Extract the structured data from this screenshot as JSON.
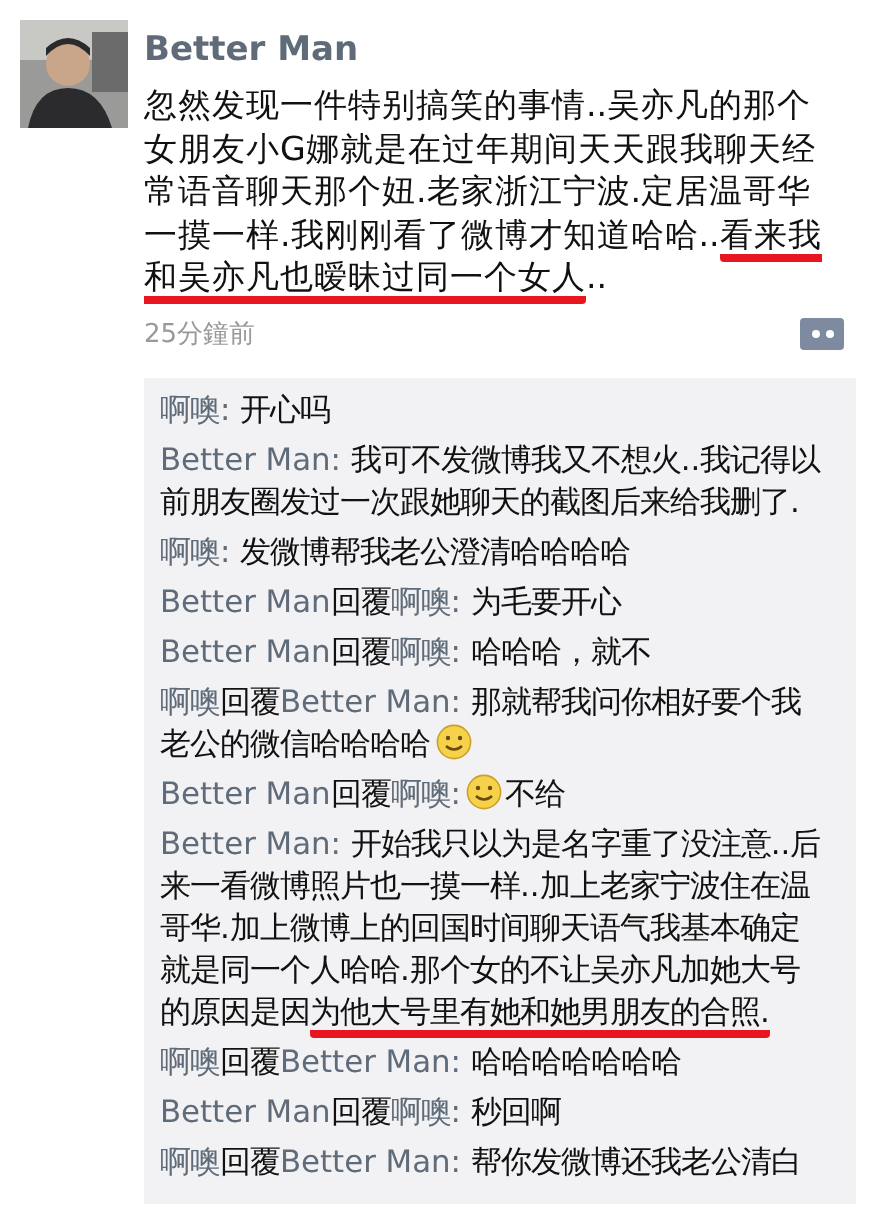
{
  "post": {
    "author": "Better Man",
    "text": [
      {
        "kind": "text",
        "text": "忽然发现一件特别搞笑的事情..吴亦凡的那个女朋友小G娜就是在过年期间天天跟我聊天经常语音聊天那个妞.老家浙江宁波.定居温哥华一摸一样.我刚刚看了微博才知道哈哈.."
      },
      {
        "kind": "underlined",
        "text": "看来我和吴亦凡也暧昧过同一个女人"
      },
      {
        "kind": "text",
        "text": ".."
      }
    ],
    "time": "25分鐘前"
  },
  "comments": [
    {
      "author": "啊噢:",
      "parts": [
        {
          "kind": "text",
          "text": " 开心吗"
        }
      ]
    },
    {
      "author": "Better Man:",
      "parts": [
        {
          "kind": "text",
          "text": " 我可不发微博我又不想火..我记得以前朋友圈发过一次跟她聊天的截图后来给我删了."
        }
      ]
    },
    {
      "author": "啊噢:",
      "parts": [
        {
          "kind": "text",
          "text": " 发微博帮我老公澄清哈哈哈哈"
        }
      ]
    },
    {
      "author": "Better Man",
      "reply_word": "回覆",
      "reply_to": "啊噢:",
      "parts": [
        {
          "kind": "text",
          "text": " 为毛要开心"
        }
      ]
    },
    {
      "author": "Better Man",
      "reply_word": "回覆",
      "reply_to": "啊噢:",
      "parts": [
        {
          "kind": "text",
          "text": " 哈哈哈，就不"
        }
      ]
    },
    {
      "author": "啊噢",
      "reply_word": "回覆",
      "reply_to": "Better Man:",
      "parts": [
        {
          "kind": "text",
          "text": " 那就帮我问你相好要个我老公的微信哈哈哈哈"
        },
        {
          "kind": "emoji"
        }
      ]
    },
    {
      "author": "Better Man",
      "reply_word": "回覆",
      "reply_to": "啊噢:",
      "parts": [
        {
          "kind": "emoji"
        },
        {
          "kind": "text",
          "text": "不给"
        }
      ]
    },
    {
      "author": "Better Man:",
      "parts": [
        {
          "kind": "text",
          "text": " 开始我只以为是名字重了没注意..后来一看微博照片也一摸一样..加上老家宁波住在温哥华.加上微博上的回国时间聊天语气我基本确定就是同一个人哈哈.那个女的不让吴亦凡加她大号的原因是因"
        },
        {
          "kind": "underlined",
          "text": "为他大号里有她和她男朋友的合照."
        }
      ]
    },
    {
      "author": "啊噢",
      "reply_word": "回覆",
      "reply_to": "Better Man:",
      "parts": [
        {
          "kind": "text",
          "text": " 哈哈哈哈哈哈哈"
        }
      ]
    },
    {
      "author": "Better Man",
      "reply_word": "回覆",
      "reply_to": "啊噢:",
      "parts": [
        {
          "kind": "text",
          "text": " 秒回啊"
        }
      ]
    },
    {
      "author": "啊噢",
      "reply_word": "回覆",
      "reply_to": "Better Man:",
      "parts": [
        {
          "kind": "text",
          "text": " 帮你发微博还我老公清白"
        }
      ]
    }
  ]
}
